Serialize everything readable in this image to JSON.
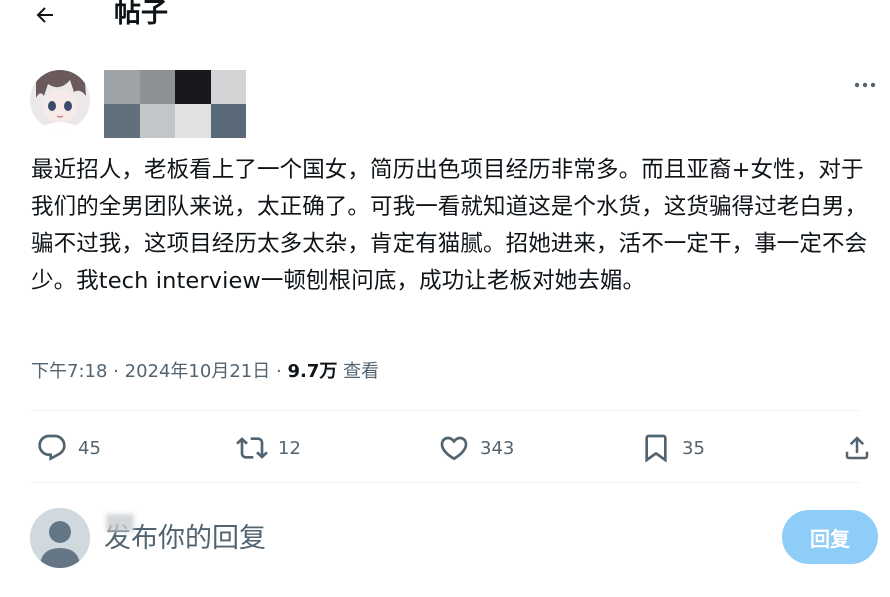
{
  "header": {
    "title": "帖子",
    "back_icon": "arrow-left-icon"
  },
  "author": {
    "avatar_icon": "anime-avatar",
    "name_obscured": true
  },
  "post": {
    "text": "最近招人，老板看上了一个国女，简历出色项目经历非常多。而且亚裔+女性，对于我们的全男团队来说，太正确了。可我一看就知道这是个水货，这货骗得过老白男，骗不过我，这项目经历太多太杂，肯定有猫腻。招她进来，活不一定干，事一定不会少。我tech interview一顿刨根问底，成功让老板对她去媚。",
    "time": "下午7:18",
    "separator": "·",
    "date": "2024年10月21日",
    "views_count": "9.7万",
    "views_label": "查看"
  },
  "actions": {
    "replies": "45",
    "retweets": "12",
    "likes": "343",
    "bookmarks": "35"
  },
  "reply": {
    "placeholder": "发布你的回复",
    "button_label": "回复"
  },
  "colors": {
    "text": "#0f1419",
    "secondary": "#536471",
    "divider": "#eff3f4",
    "reply_button": "#8ecdf7"
  }
}
